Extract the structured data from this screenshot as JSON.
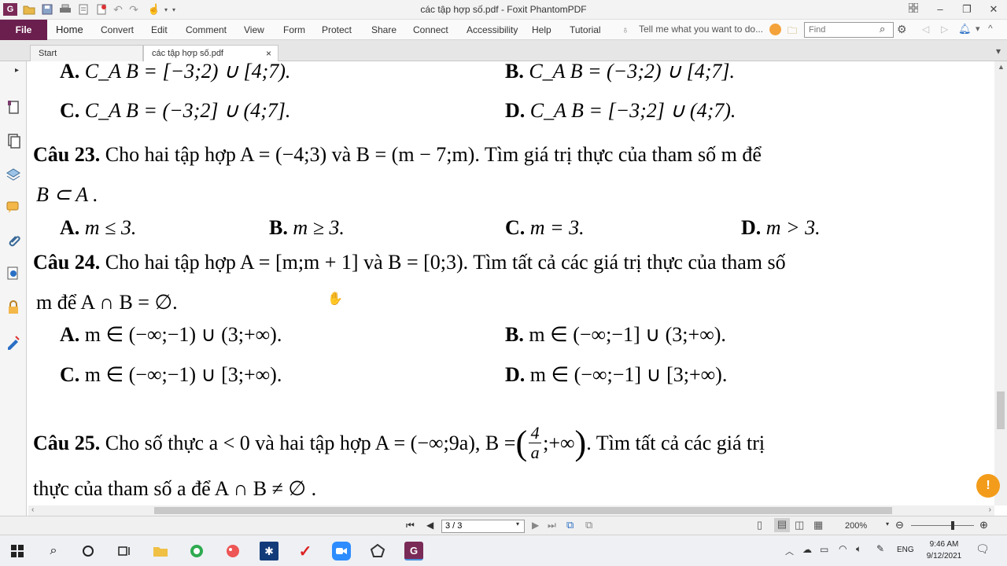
{
  "window": {
    "title": "các tập hợp số.pdf - Foxit PhantomPDF"
  },
  "ribbon": {
    "file": "File",
    "menus": [
      "Home",
      "Convert",
      "Edit",
      "Comment",
      "View",
      "Form",
      "Protect",
      "Share",
      "Connect",
      "Accessibility",
      "Help",
      "Tutorial"
    ],
    "tell_me": "Tell me what you want to do...",
    "find_placeholder": "Find"
  },
  "tabs": [
    {
      "label": "Start"
    },
    {
      "label": "các tập hợp số.pdf"
    }
  ],
  "document": {
    "q22": {
      "A": {
        "label": "A.",
        "math": "C_A B = [−3;2) ∪ [4;7)."
      },
      "B": {
        "label": "B.",
        "math": "C_A B = (−3;2) ∪ [4;7]."
      },
      "C": {
        "label": "C.",
        "math": "C_A B = (−3;2] ∪ (4;7]."
      },
      "D": {
        "label": "D.",
        "math": "C_A B = [−3;2] ∪ (4;7)."
      }
    },
    "q23": {
      "label": "Câu 23.",
      "text1": "Cho hai tập hợp  A = (−4;3)  và  B = (m − 7;m). Tìm giá trị thực của tham số  m  để",
      "text2": "B ⊂ A .",
      "A": {
        "label": "A.",
        "math": "m ≤ 3."
      },
      "B": {
        "label": "B.",
        "math": "m ≥ 3."
      },
      "C": {
        "label": "C.",
        "math": "m = 3."
      },
      "D": {
        "label": "D.",
        "math": "m > 3."
      }
    },
    "q24": {
      "label": "Câu 24.",
      "text1": "Cho hai tập hợp  A = [m;m + 1]  và  B = [0;3). Tìm tất cả các giá trị thực của tham số",
      "text2": "m  để  A ∩ B = ∅.",
      "A": {
        "label": "A.",
        "math": "m ∈ (−∞;−1) ∪ (3;+∞)."
      },
      "B": {
        "label": "B.",
        "math": "m ∈ (−∞;−1] ∪ (3;+∞)."
      },
      "C": {
        "label": "C.",
        "math": "m ∈ (−∞;−1) ∪ [3;+∞)."
      },
      "D": {
        "label": "D.",
        "math": "m ∈ (−∞;−1] ∪ [3;+∞)."
      }
    },
    "q25": {
      "label": "Câu 25.",
      "text1a": "Cho số thực  a < 0  và hai tập hợp  A = (−∞;9a),  B = ",
      "frac_num": "4",
      "frac_den": "a",
      "text1b": ";+∞",
      "text1c": ". Tìm tất cả các giá trị",
      "text2": "thực của tham số  a  để  A ∩ B ≠ ∅ ."
    }
  },
  "status": {
    "page": "3 / 3",
    "zoom": "200%"
  },
  "taskbar": {
    "lang": "ENG",
    "time": "9:46 AM",
    "date": "9/12/2021"
  },
  "colors": {
    "file_bg": "#6b1f4e",
    "help_btn": "#f39c1b"
  }
}
